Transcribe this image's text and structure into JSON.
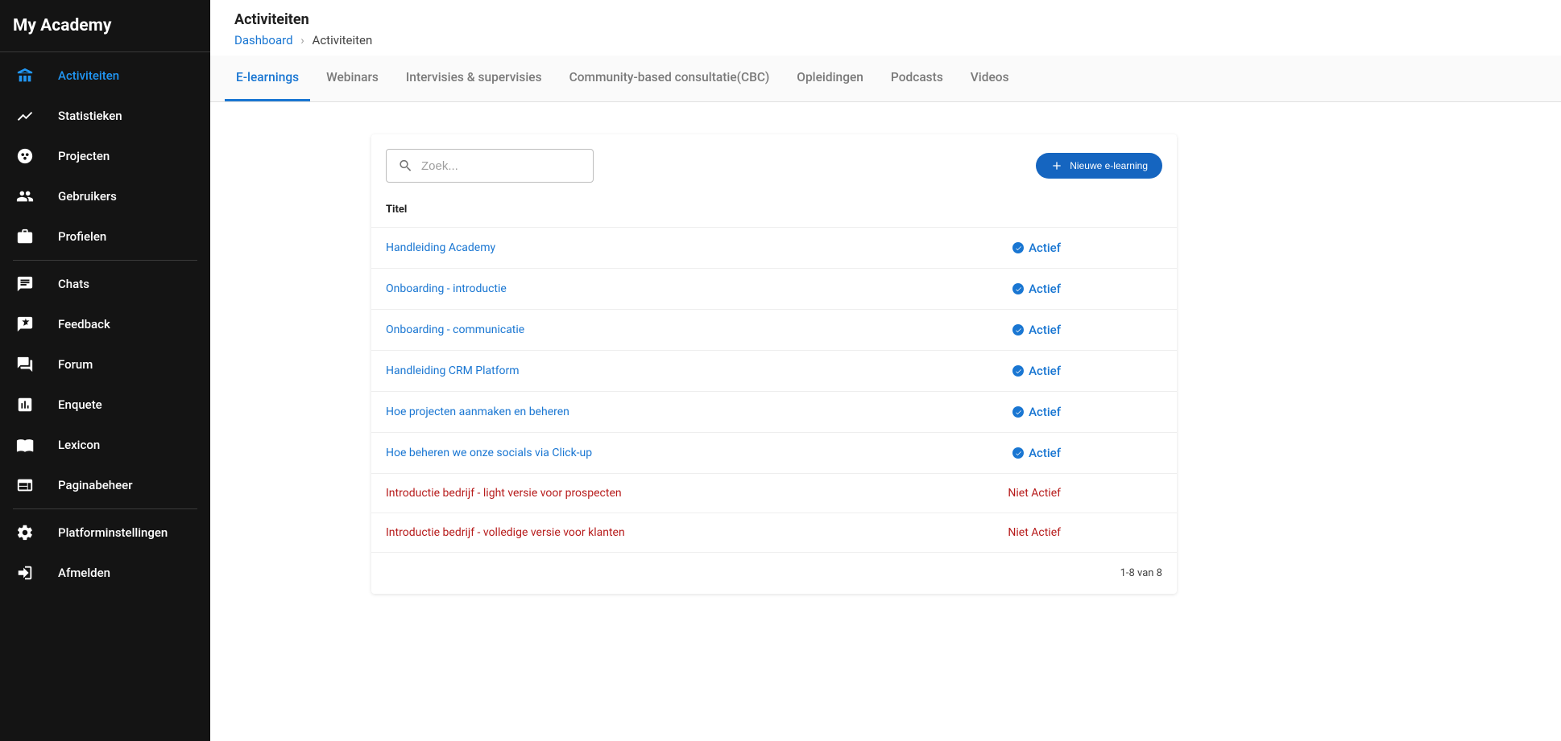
{
  "app": {
    "title": "My Academy"
  },
  "sidebar": {
    "items": [
      {
        "label": "Activiteiten",
        "icon": "activities",
        "active": true
      },
      {
        "label": "Statistieken",
        "icon": "chart"
      },
      {
        "label": "Projecten",
        "icon": "projects"
      },
      {
        "label": "Gebruikers",
        "icon": "people"
      },
      {
        "label": "Profielen",
        "icon": "briefcase",
        "dividerAfter": true
      },
      {
        "label": "Chats",
        "icon": "chat"
      },
      {
        "label": "Feedback",
        "icon": "review"
      },
      {
        "label": "Forum",
        "icon": "forum"
      },
      {
        "label": "Enquete",
        "icon": "poll"
      },
      {
        "label": "Lexicon",
        "icon": "book"
      },
      {
        "label": "Paginabeheer",
        "icon": "web",
        "dividerAfter": true
      },
      {
        "label": "Platforminstellingen",
        "icon": "settings"
      },
      {
        "label": "Afmelden",
        "icon": "exit"
      }
    ]
  },
  "header": {
    "title": "Activiteiten",
    "breadcrumb_root": "Dashboard",
    "breadcrumb_current": "Activiteiten"
  },
  "tabs": [
    "E-learnings",
    "Webinars",
    "Intervisies & supervisies",
    "Community-based consultatie(CBC)",
    "Opleidingen",
    "Podcasts",
    "Videos"
  ],
  "search": {
    "placeholder": "Zoek..."
  },
  "buttons": {
    "new_elearning": "Nieuwe e-learning"
  },
  "table": {
    "header_title": "Titel",
    "status_active": "Actief",
    "status_inactive": "Niet Actief",
    "rows": [
      {
        "title": "Handleiding Academy",
        "active": true
      },
      {
        "title": "Onboarding - introductie",
        "active": true
      },
      {
        "title": "Onboarding - communicatie",
        "active": true
      },
      {
        "title": "Handleiding CRM Platform",
        "active": true
      },
      {
        "title": "Hoe projecten aanmaken en beheren",
        "active": true
      },
      {
        "title": "Hoe beheren we onze socials via Click-up",
        "active": true
      },
      {
        "title": "Introductie bedrijf - light versie voor prospecten",
        "active": false
      },
      {
        "title": "Introductie bedrijf - volledige versie voor klanten",
        "active": false
      }
    ],
    "footer": "1-8 van 8"
  }
}
